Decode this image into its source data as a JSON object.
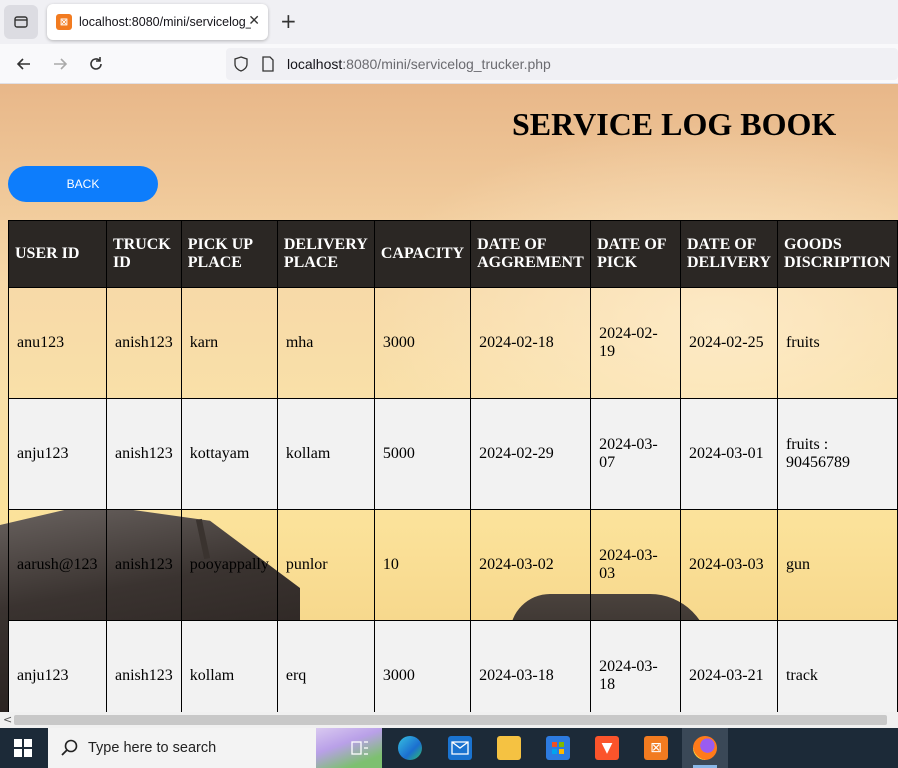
{
  "browser": {
    "tab_title": "localhost:8080/mini/servicelog_",
    "new_tab": "+",
    "close": "✕",
    "url_host": "localhost",
    "url_rest": ":8080/mini/servicelog_trucker.php"
  },
  "page": {
    "heading": "SERVICE LOG BOOK",
    "back_label": "BACK"
  },
  "table": {
    "headers": [
      [
        "USER ID"
      ],
      [
        "TRUCK",
        "ID"
      ],
      [
        "PICK UP",
        "PLACE"
      ],
      [
        "DELIVERY",
        "PLACE"
      ],
      [
        "CAPACITY"
      ],
      [
        "DATE OF",
        "AGGREMENT"
      ],
      [
        "DATE OF",
        "PICK"
      ],
      [
        "DATE OF",
        "DELIVERY"
      ],
      [
        "GOODS",
        "DISCRIPTION"
      ]
    ],
    "rows": [
      [
        "anu123",
        "anish123",
        "karn",
        "mha",
        "3000",
        "2024-02-18",
        "2024-02-19",
        "2024-02-25",
        "fruits"
      ],
      [
        "anju123",
        "anish123",
        "kottayam",
        "kollam",
        "5000",
        "2024-02-29",
        "2024-03-07",
        "2024-03-01",
        "fruits : 90456789"
      ],
      [
        "aarush@123",
        "anish123",
        "pooyappally",
        "punlor",
        "10",
        "2024-03-02",
        "2024-03-03",
        "2024-03-03",
        "gun"
      ],
      [
        "anju123",
        "anish123",
        "kollam",
        "erq",
        "3000",
        "2024-03-18",
        "2024-03-18",
        "2024-03-21",
        "track"
      ]
    ]
  },
  "scrollbar": {
    "left_arrow": "<"
  },
  "taskbar": {
    "search_placeholder": "Type here to search",
    "apps": [
      "task-view",
      "edge",
      "mail",
      "file-explorer",
      "store",
      "brave",
      "xampp",
      "firefox"
    ]
  },
  "colors": {
    "table_header_bg": "#2b2724",
    "back_button": "#0d7dfc",
    "row_even_bg": "#f2f2f2",
    "taskbar": "#1c2a38"
  }
}
